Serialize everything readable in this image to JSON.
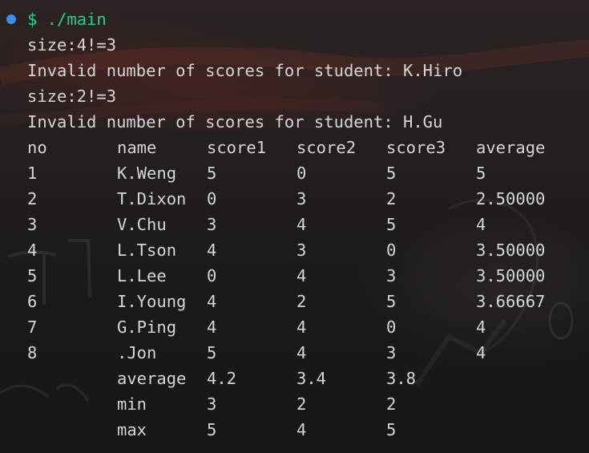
{
  "terminal": {
    "prompt_symbol": "$",
    "command": "./main",
    "errors": [
      {
        "size": "size:4!=3",
        "message": "Invalid number of scores for student: K.Hiro"
      },
      {
        "size": "size:2!=3",
        "message": "Invalid number of scores for student: H.Gu"
      }
    ],
    "table": {
      "headers": [
        "no",
        "name",
        "score1",
        "score2",
        "score3",
        "average"
      ],
      "rows": [
        [
          "1",
          "K.Weng",
          "5",
          "0",
          "5",
          "5"
        ],
        [
          "2",
          "T.Dixon",
          "0",
          "3",
          "2",
          "2.50000"
        ],
        [
          "3",
          "V.Chu",
          "3",
          "4",
          "5",
          "4"
        ],
        [
          "4",
          "L.Tson",
          "4",
          "3",
          "0",
          "3.50000"
        ],
        [
          "5",
          "L.Lee",
          "0",
          "4",
          "3",
          "3.50000"
        ],
        [
          "6",
          "I.Young",
          "4",
          "2",
          "5",
          "3.66667"
        ],
        [
          "7",
          "G.Ping",
          "4",
          "4",
          "0",
          "4"
        ],
        [
          "8",
          ".Jon",
          "5",
          "4",
          "3",
          "4"
        ]
      ],
      "summary": [
        [
          "",
          "average",
          "4.2",
          "3.4",
          "3.8",
          ""
        ],
        [
          "",
          "min",
          "3",
          "2",
          "2",
          ""
        ],
        [
          "",
          "max",
          "5",
          "4",
          "5",
          ""
        ]
      ]
    }
  },
  "colors": {
    "text": "#d6d6d6",
    "prompt": "#23d18b",
    "status_dot": "#3a8ee6"
  }
}
